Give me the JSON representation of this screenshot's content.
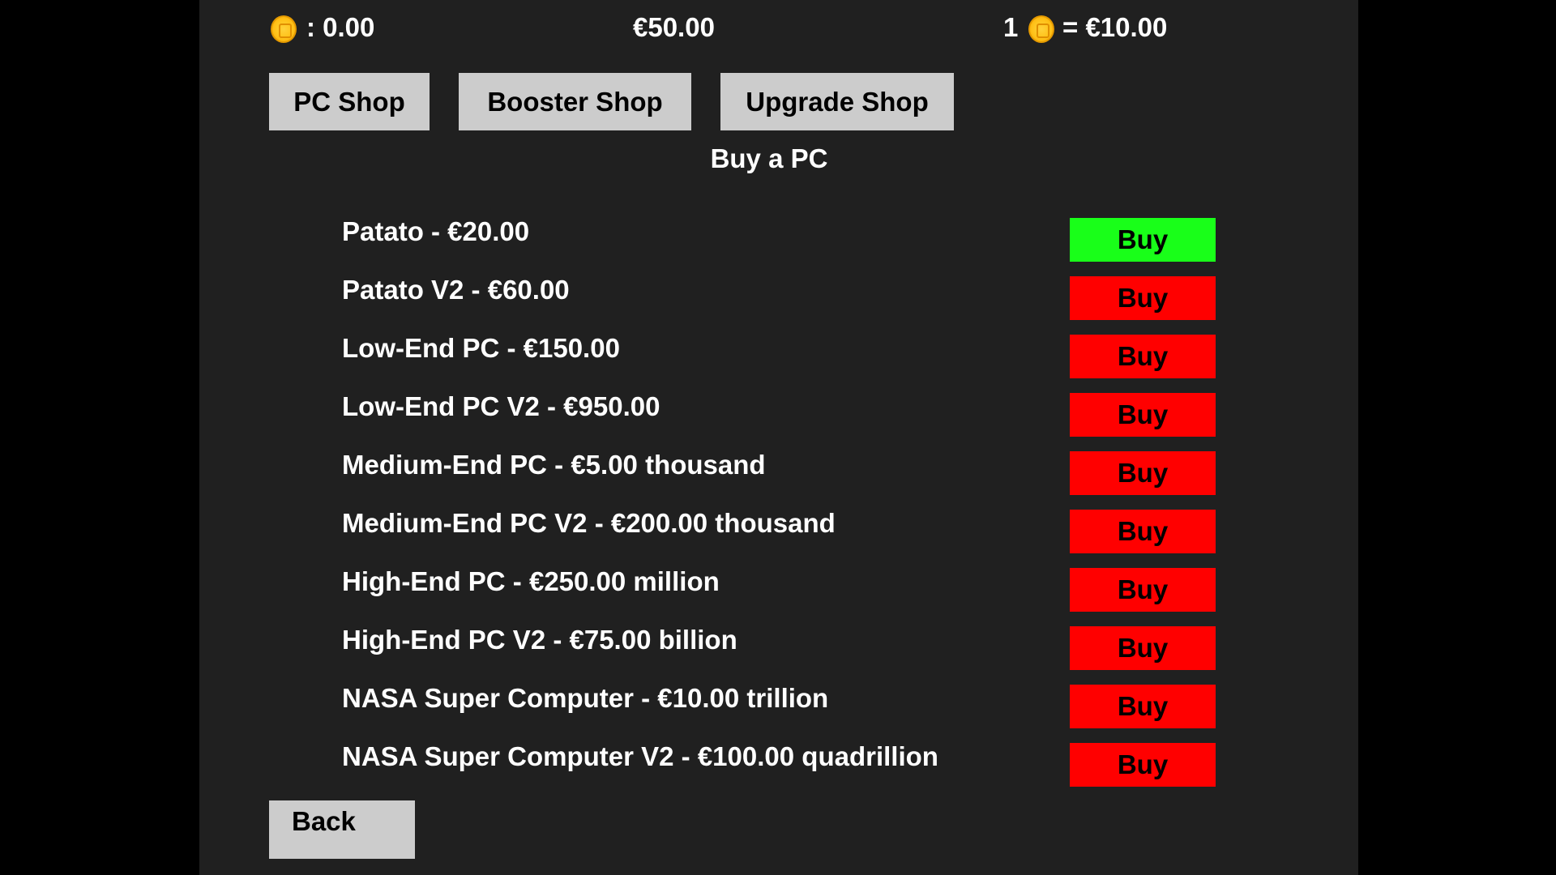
{
  "hud": {
    "coins_label": ": 0.00",
    "money": "€50.00",
    "rate_prefix": "1",
    "rate_value": "= €10.00",
    "coin_icon": "coin-icon",
    "coin_color": "#ffc21a"
  },
  "tabs": [
    {
      "label": "PC Shop"
    },
    {
      "label": "Booster Shop"
    },
    {
      "label": "Upgrade Shop"
    }
  ],
  "section_title": "Buy a PC",
  "items": [
    {
      "label": "Patato - €20.00",
      "button": "Buy",
      "affordable": true
    },
    {
      "label": "Patato V2 - €60.00",
      "button": "Buy",
      "affordable": false
    },
    {
      "label": "Low-End PC - €150.00",
      "button": "Buy",
      "affordable": false
    },
    {
      "label": "Low-End PC V2 - €950.00",
      "button": "Buy",
      "affordable": false
    },
    {
      "label": "Medium-End PC - €5.00 thousand",
      "button": "Buy",
      "affordable": false
    },
    {
      "label": "Medium-End PC V2 - €200.00 thousand",
      "button": "Buy",
      "affordable": false
    },
    {
      "label": "High-End PC - €250.00 million",
      "button": "Buy",
      "affordable": false
    },
    {
      "label": "High-End PC V2 - €75.00 billion",
      "button": "Buy",
      "affordable": false
    },
    {
      "label": "NASA Super Computer - €10.00 trillion",
      "button": "Buy",
      "affordable": false
    },
    {
      "label": "NASA Super Computer V2 - €100.00 quadrillion",
      "button": "Buy",
      "affordable": false
    }
  ],
  "back_label": "Back",
  "colors": {
    "affordable": "#19ff19",
    "locked": "#ff0000",
    "button_gray": "#cccccc",
    "panel": "#202020"
  }
}
